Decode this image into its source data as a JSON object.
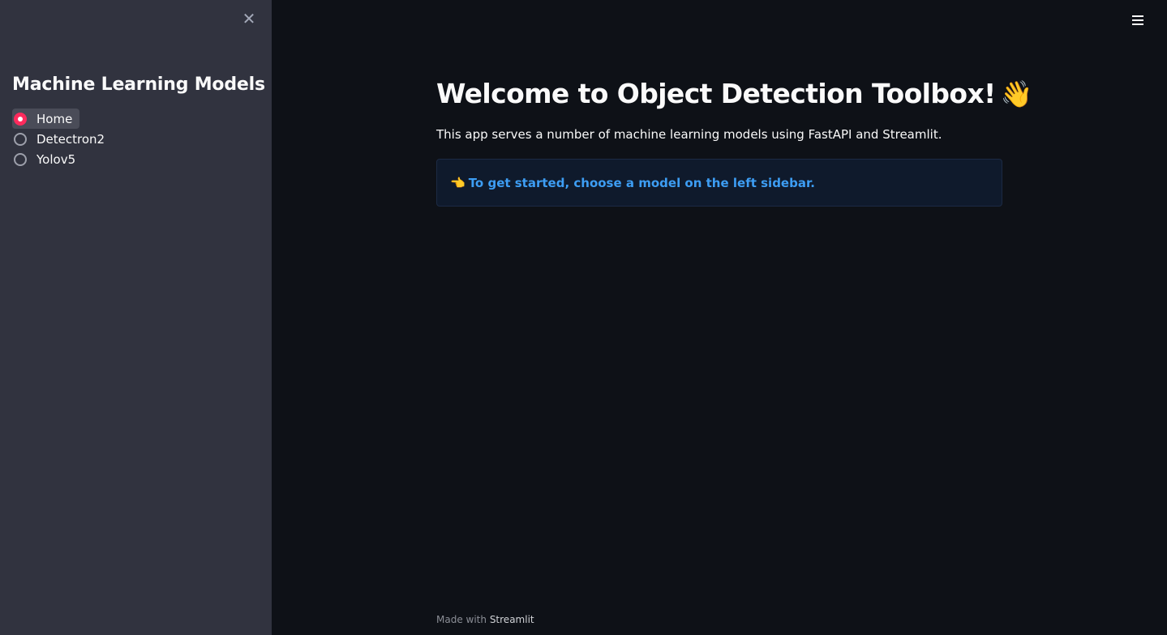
{
  "sidebar": {
    "close_icon": "close-icon",
    "title": "Machine Learning Models",
    "options": [
      {
        "label": "Home",
        "selected": true
      },
      {
        "label": "Detectron2",
        "selected": false
      },
      {
        "label": "Yolov5",
        "selected": false
      }
    ],
    "accent_color": "#ff2b5d"
  },
  "header": {
    "menu_icon": "hamburger-menu-icon"
  },
  "main": {
    "title": "Welcome to Object Detection Toolbox!",
    "title_emoji": "👋",
    "intro": "This app serves a number of machine learning models using FastAPI and Streamlit.",
    "info": {
      "icon": "👈",
      "text": "To get started, choose a model on the left sidebar.",
      "text_color": "#3d9df3"
    }
  },
  "footer": {
    "prefix": "Made with",
    "brand": "Streamlit"
  }
}
